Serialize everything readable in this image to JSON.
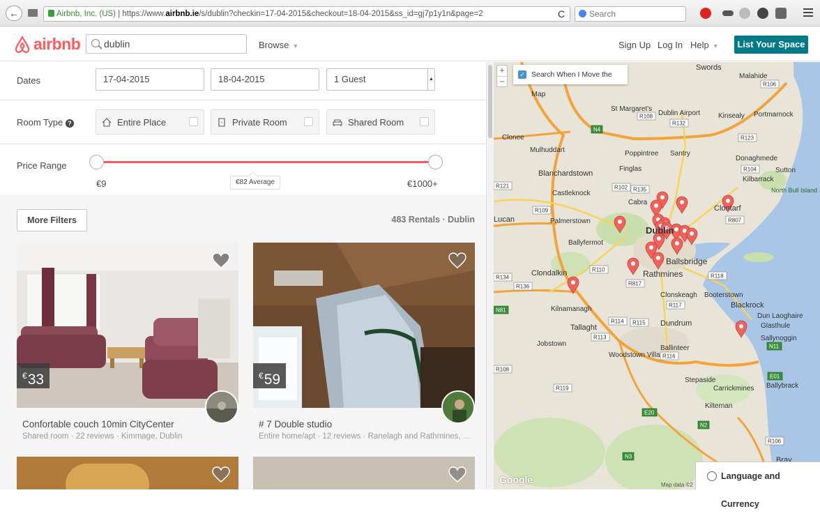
{
  "browser": {
    "site_identity": "Airbnb, Inc. (US)",
    "url_prefix": "https://www.",
    "url_domain": "airbnb.ie",
    "url_path": "/s/dublin?checkin=17-04-2015&checkout=18-04-2015&ss_id=gj7p1y1n&page=2",
    "search_placeholder": "Search"
  },
  "header": {
    "logo_text": "airbnb",
    "search_value": "dublin",
    "browse_label": "Browse",
    "signup_label": "Sign Up",
    "login_label": "Log In",
    "help_label": "Help",
    "list_space_label": "List Your Space"
  },
  "filters": {
    "dates_label": "Dates",
    "checkin": "17-04-2015",
    "checkout": "18-04-2015",
    "guests": "1 Guest",
    "room_type_label": "Room Type",
    "room_types": [
      "Entire Place",
      "Private Room",
      "Shared Room"
    ],
    "price_range_label": "Price Range",
    "price_min": "€9",
    "price_avg": "€82 Average",
    "price_max": "€1000+"
  },
  "results": {
    "more_filters_label": "More Filters",
    "count_text": "483 Rentals · Dublin",
    "listings": [
      {
        "currency": "€",
        "price": "33",
        "title": "Confortable couch 10min CityCenter",
        "subtitle": "Shared room · 22 reviews · Kimmage, Dublin"
      },
      {
        "currency": "€",
        "price": "59",
        "title": "# 7 Double studio",
        "subtitle": "Entire home/apt · 12 reviews · Ranelagh and Rathmines, R..."
      }
    ]
  },
  "map": {
    "search_when_move_label": "Search When I Move the Map",
    "zoom_in": "+",
    "zoom_out": "−",
    "language_currency_label": "Language and Currency",
    "attribution": "Map data ©2",
    "google_logo": "Google",
    "places": [
      "Swords",
      "Malahide",
      "St Margaret's",
      "Dublin Airport",
      "Kinsealy",
      "Portmarnock",
      "Clonee",
      "Mulhuddart",
      "Poppintree",
      "Santry",
      "Donaghmede",
      "Blanchardstown",
      "Finglas",
      "Sutton",
      "Kilbarrack",
      "North Bull Island",
      "Castleknock",
      "Cabra",
      "Clontarf",
      "Lucan",
      "Palmerstown",
      "Dublin",
      "Ballyfermot",
      "Ballsbridge",
      "Clondalkin",
      "Rathmines",
      "Clonskeagh",
      "Booterstown",
      "Blackrock",
      "Kilnamanagh",
      "Dun Laoghaire",
      "Glasthule",
      "Tallaght",
      "Dundrum",
      "Sallynoggin",
      "Jobstown",
      "Ballinteer",
      "Woodstown Village",
      "Stepaside",
      "Carrickmines",
      "Ballybrack",
      "Kilternan",
      "Bray"
    ],
    "road_labels": [
      "R106",
      "R108",
      "R132",
      "R123",
      "R104",
      "R121",
      "R102",
      "R135",
      "R109",
      "R807",
      "R110",
      "R134",
      "R136",
      "R817",
      "R118",
      "R117",
      "R114",
      "R115",
      "R113",
      "R119",
      "R116",
      "E01",
      "E20",
      "N2",
      "N3",
      "N4",
      "N81",
      "N11"
    ]
  },
  "colors": {
    "brand": "#ff5a5f",
    "list_space_btn": "#007a87",
    "map_pin": "#f0625c"
  }
}
